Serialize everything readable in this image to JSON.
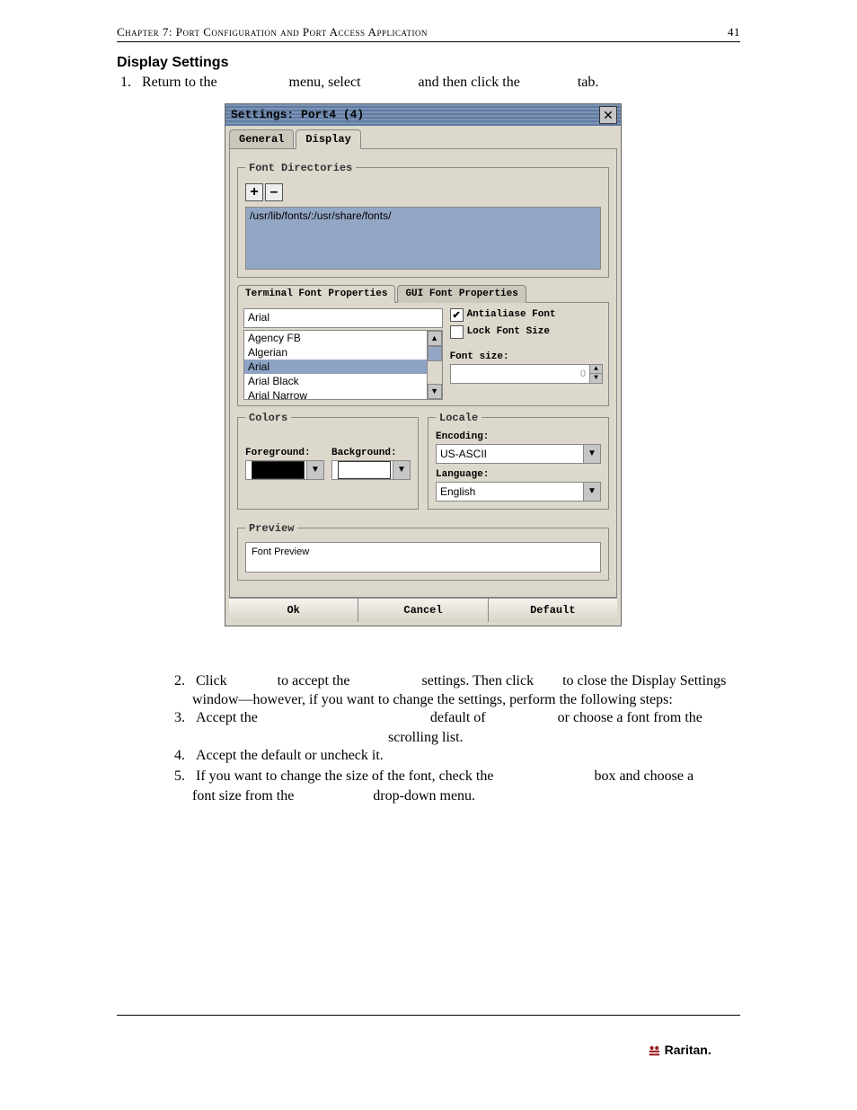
{
  "header": {
    "chapter": "Chapter 7: Port Configuration and Port Access Application",
    "page": "41"
  },
  "sectionTitle": "Display Settings",
  "steps": {
    "s1": {
      "num": "1.",
      "before": "Return to the ",
      "mid1": " menu, select ",
      "mid2": " and then click the ",
      "after": " tab."
    },
    "s2": {
      "num": "2.",
      "line1a": "Click ",
      "line1b": " to accept the ",
      "line1c": " settings. Then click ",
      "line1d": " to close the Display Settings",
      "line2": "window—however, if you want to change the settings, perform the following steps:"
    },
    "s3": {
      "num": "3.",
      "line1a": "Accept  the  ",
      "line1b": "  default  of  ",
      "line1c": "  or  choose  a  font  from  the",
      "line2": "scrolling list."
    },
    "s4": {
      "num": "4.",
      "text": "Accept the                             default or uncheck it."
    },
    "s5": {
      "num": "5.",
      "line1a": "If you want to change the size of the font, check the ",
      "line1b": " box and choose a",
      "line2a": "font size from the ",
      "line2b": " drop-down menu."
    }
  },
  "dialog": {
    "title": "Settings: Port4 (4)",
    "close": "✕",
    "tabs": {
      "general": "General",
      "display": "Display"
    },
    "fontDir": {
      "legend": "Font Directories",
      "plus": "+",
      "minus": "–",
      "path": "/usr/lib/fonts/:/usr/share/fonts/"
    },
    "innerTabs": {
      "term": "Terminal Font Properties",
      "gui": "GUI Font Properties"
    },
    "fonts": {
      "current": "Arial",
      "list": [
        "Agency FB",
        "Algerian",
        "Arial",
        "Arial Black",
        "Arial Narrow"
      ],
      "antialiase": "Antialiase Font",
      "lock": "Lock Font Size",
      "sizeLabel": "Font size:",
      "sizeVal": "0"
    },
    "colors": {
      "legend": "Colors",
      "fg": "Foreground:",
      "bg": "Background:"
    },
    "locale": {
      "legend": "Locale",
      "enc": "Encoding:",
      "encVal": "US-ASCII",
      "lang": "Language:",
      "langVal": "English"
    },
    "preview": {
      "legend": "Preview",
      "text": "Font Preview"
    },
    "buttons": {
      "ok": "Ok",
      "cancel": "Cancel",
      "def": "Default"
    }
  },
  "logoText": "Raritan."
}
